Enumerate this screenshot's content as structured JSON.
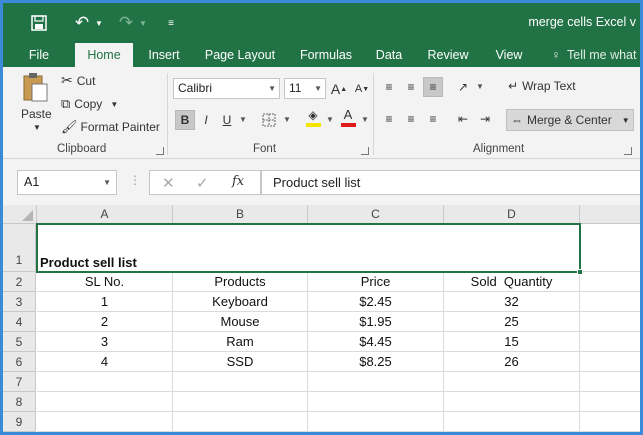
{
  "title_bar": {
    "title": "merge cells Excel v"
  },
  "tabs": [
    "File",
    "Home",
    "Insert",
    "Page Layout",
    "Formulas",
    "Data",
    "Review",
    "View"
  ],
  "tell_me": "Tell me what",
  "clipboard": {
    "paste": "Paste",
    "cut": "Cut",
    "copy": "Copy",
    "format_painter": "Format Painter",
    "label": "Clipboard"
  },
  "font": {
    "name": "Calibri",
    "size": "11",
    "grow": "A",
    "shrink": "A",
    "bold": "B",
    "italic": "I",
    "underline": "U",
    "font_color_glyph": "A",
    "label": "Font"
  },
  "alignment": {
    "wrap_text": "Wrap Text",
    "merge_center": "Merge & Center",
    "label": "Alignment"
  },
  "formula_bar": {
    "name_box": "A1",
    "fx": "fx",
    "content": "Product sell list"
  },
  "sheet": {
    "columns": [
      "A",
      "B",
      "C",
      "D"
    ],
    "row_numbers": [
      "1",
      "2",
      "3",
      "4",
      "5",
      "6",
      "7",
      "8",
      "9"
    ],
    "merged_title": "Product sell list",
    "headers": [
      "SL No.",
      "Products",
      "Price",
      "Sold  Quantity"
    ],
    "rows": [
      [
        "1",
        "Keyboard",
        "$2.45",
        "32"
      ],
      [
        "2",
        "Mouse",
        "$1.95",
        "25"
      ],
      [
        "3",
        "Ram",
        "$4.45",
        "15"
      ],
      [
        "4",
        "SSD",
        "$8.25",
        "26"
      ]
    ]
  },
  "colors": {
    "excel_green": "#217346",
    "ribbon_bg": "#f3f3f3",
    "window_border": "#3a8ad8"
  }
}
